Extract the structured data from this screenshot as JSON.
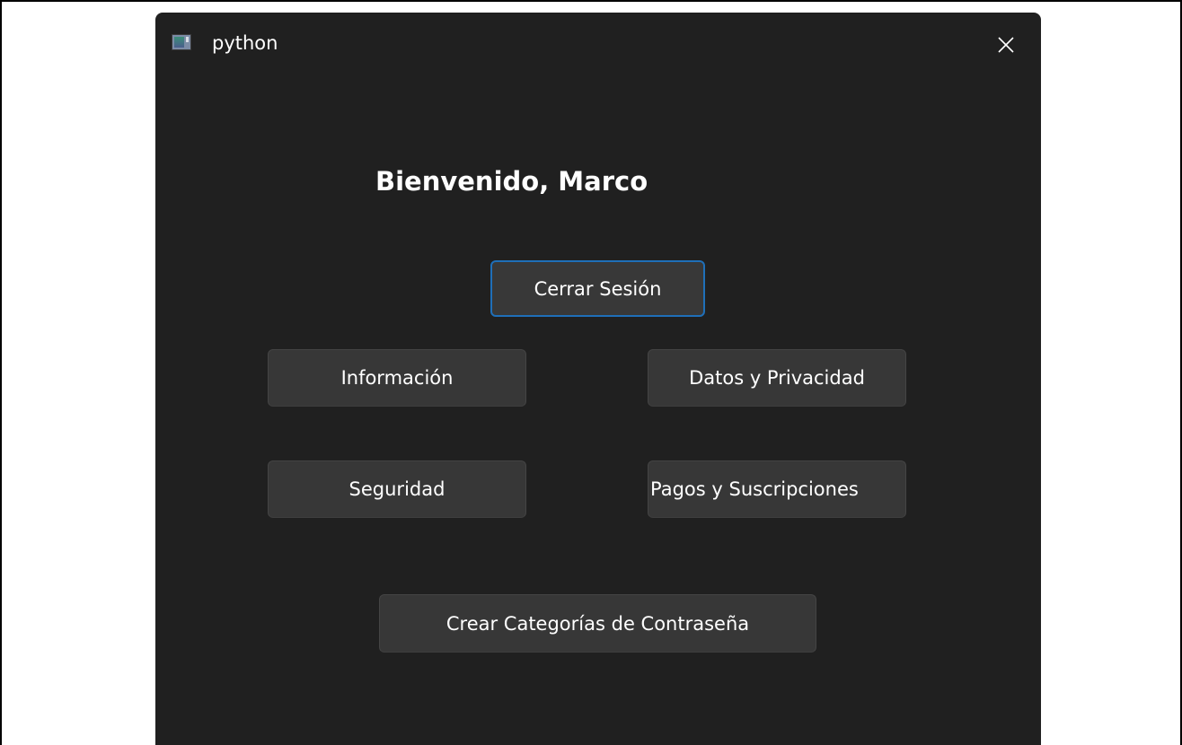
{
  "window": {
    "title": "python",
    "icon": "python-app-icon",
    "close_icon": "close-icon"
  },
  "main": {
    "welcome_text": "Bienvenido, Marco",
    "buttons": {
      "logout": "Cerrar Sesión",
      "info": "Información",
      "privacy": "Datos y Privacidad",
      "security": "Seguridad",
      "payments": "Pagos y Suscripciones",
      "categories": "Crear Categorías de Contraseña"
    }
  },
  "colors": {
    "window_background": "#202020",
    "button_background": "#373737",
    "focus_border": "#1f6fb8",
    "text": "#ffffff"
  }
}
